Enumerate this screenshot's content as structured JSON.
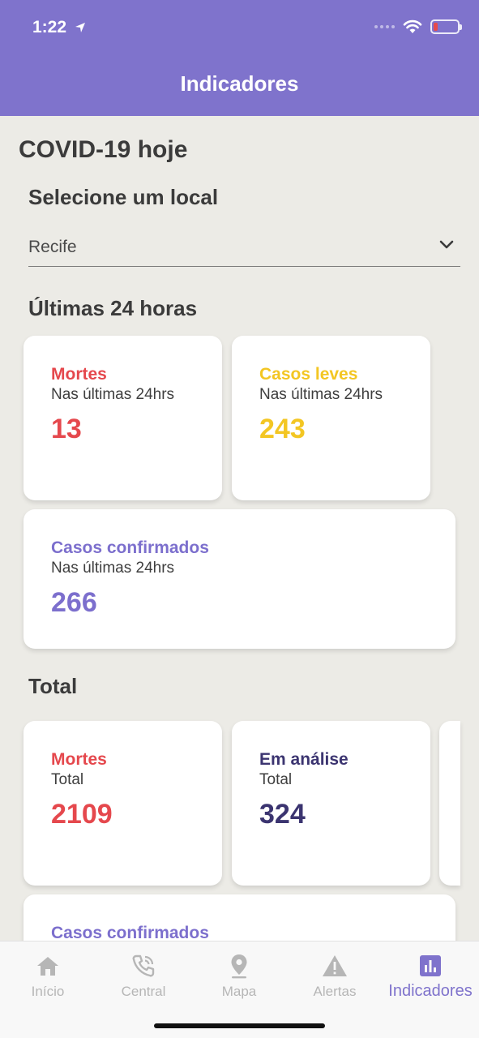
{
  "status_bar": {
    "time": "1:22"
  },
  "header": {
    "title": "Indicadores"
  },
  "page": {
    "heading": "COVID-19 hoje",
    "select_label": "Selecione um local",
    "select_value": "Recife"
  },
  "sections": {
    "last24": "Últimas 24 horas",
    "total": "Total"
  },
  "cards_24h": [
    {
      "title": "Mortes",
      "subtitle": "Nas últimas 24hrs",
      "value": "13",
      "color": "#e5484d"
    },
    {
      "title": "Casos leves",
      "subtitle": "Nas últimas 24hrs",
      "value": "243",
      "color": "#f3c623"
    },
    {
      "title": "Casos confirmados",
      "subtitle": "Nas últimas 24hrs",
      "value": "266",
      "color": "#7c6fcd"
    }
  ],
  "cards_total": [
    {
      "title": "Mortes",
      "subtitle": "Total",
      "value": "2109",
      "color": "#e5484d"
    },
    {
      "title": "Em análise",
      "subtitle": "Total",
      "value": "324",
      "color": "#3b3470"
    },
    {
      "title": "Casos confirmados",
      "color": "#7c6fcd"
    }
  ],
  "tabbar": {
    "items": [
      {
        "label": "Início",
        "icon": "home-icon"
      },
      {
        "label": "Central",
        "icon": "phone-icon"
      },
      {
        "label": "Mapa",
        "icon": "map-pin-icon"
      },
      {
        "label": "Alertas",
        "icon": "warning-icon"
      },
      {
        "label": "Indicadores",
        "icon": "bar-chart-icon",
        "active": true
      }
    ]
  },
  "colors": {
    "brand": "#7f73cc",
    "background": "#ecebe6"
  }
}
